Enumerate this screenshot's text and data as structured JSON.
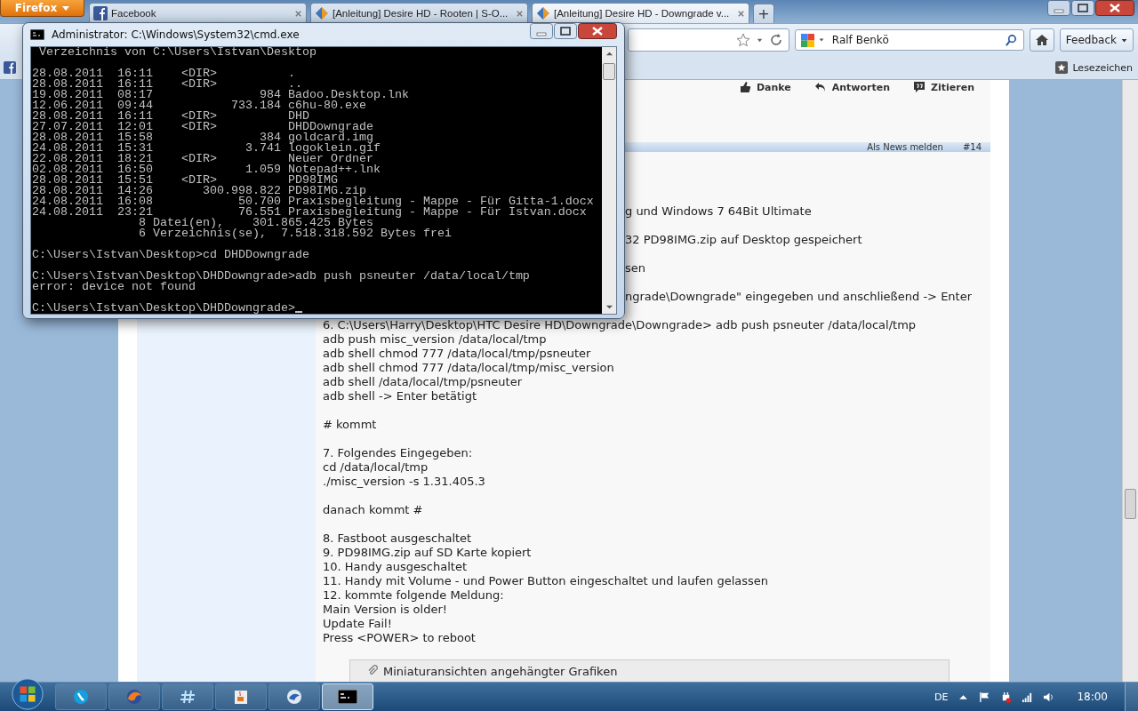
{
  "browser": {
    "menu_button": "Firefox",
    "tabs": [
      {
        "title": "Facebook",
        "kind": "square",
        "selected": false
      },
      {
        "title": "[Anleitung] Desire HD - Rooten | S-O...",
        "kind": "diamond",
        "selected": false
      },
      {
        "title": "[Anleitung] Desire HD - Downgrade v...",
        "kind": "diamond",
        "selected": true
      }
    ],
    "new_tab": "+",
    "search": {
      "value": "Ralf Benkö"
    },
    "feedback_button": "Feedback",
    "bookmarks_button": "Lesezeichen"
  },
  "console": {
    "title": "Administrator: C:\\Windows\\System32\\cmd.exe",
    "blocks": [
      [
        " Verzeichnis von C:\\Users\\Istvan\\Desktop"
      ],
      [
        "28.08.2011  16:11    <DIR>          .",
        "28.08.2011  16:11    <DIR>          ..",
        "19.08.2011  08:17               984 Badoo.Desktop.lnk",
        "12.06.2011  09:44           733.184 c6hu-80.exe",
        "28.08.2011  16:11    <DIR>          DHD",
        "27.07.2011  12:01    <DIR>          DHDDowngrade",
        "28.08.2011  15:58               384 goldcard.img",
        "24.08.2011  15:31             3.741 logoklein.gif",
        "22.08.2011  18:21    <DIR>          Neuer Ordner",
        "02.08.2011  16:50             1.059 Notepad++.lnk",
        "28.08.2011  15:51    <DIR>          PD98IMG",
        "28.08.2011  14:26       300.998.822 PD98IMG.zip",
        "24.08.2011  16:08            50.700 Praxisbegleitung - Mappe - Für Gitta-1.docx",
        "24.08.2011  23:21            76.551 Praxisbegleitung - Mappe - Für Istvan.docx",
        "               8 Datei(en),    301.865.425 Bytes",
        "               6 Verzeichnis(se),  7.518.318.592 Bytes frei"
      ],
      [
        "C:\\Users\\Istvan\\Desktop>cd DHDDowngrade"
      ],
      [
        "C:\\Users\\Istvan\\Desktop\\DHDDowngrade>adb push psneuter /data/local/tmp",
        "error: device not found"
      ],
      [
        "C:\\Users\\Istvan\\Desktop\\DHDDowngrade>"
      ]
    ]
  },
  "post_actions": [
    {
      "label": "Danke",
      "kind": "thanks"
    },
    {
      "label": "Antworten",
      "kind": "reply"
    },
    {
      "label": "Zitieren",
      "kind": "quote"
    }
  ],
  "post": {
    "report_link": "Als News melden",
    "number": "#14",
    "paragraphs": [
      {
        "cut": true,
        "lines": [
          "g und Windows 7 64Bit Ultimate"
        ]
      },
      {
        "cut": true,
        "lines": [
          "32 PD98IMG.zip auf Desktop gespeichert"
        ]
      },
      {
        "cut": true,
        "lines": [
          "sen"
        ]
      },
      {
        "cut": true,
        "lines": [
          "ngrade\\Downgrade\" eingegeben und anschließend -> Enter"
        ]
      },
      {
        "cut": false,
        "lines": [
          "6. C:\\Users\\Harry\\Desktop\\HTC Desire HD\\Downgrade\\Downgrade> adb push psneuter /data/local/tmp",
          "adb push misc_version /data/local/tmp",
          "adb shell chmod 777 /data/local/tmp/psneuter",
          "adb shell chmod 777 /data/local/tmp/misc_version",
          "adb shell /data/local/tmp/psneuter",
          "adb shell -> Enter betätigt"
        ]
      },
      {
        "cut": false,
        "lines": [
          "# kommt"
        ]
      },
      {
        "cut": false,
        "lines": [
          "7. Folgendes Eingegeben:",
          "cd /data/local/tmp",
          "./misc_version -s 1.31.405.3"
        ]
      },
      {
        "cut": false,
        "lines": [
          "danach kommt #"
        ]
      },
      {
        "cut": false,
        "lines": [
          "8. Fastboot ausgeschaltet",
          "9. PD98IMG.zip auf SD Karte kopiert",
          "10. Handy ausgeschaltet",
          "11. Handy mit Volume - und Power Button eingeschaltet und laufen gelassen",
          "12. kommte folgende Meldung:",
          "Main Version is older!",
          "Update Fail!",
          "Press <POWER> to reboot"
        ]
      }
    ],
    "attachments_title": "Miniaturansichten angehängter Grafiken"
  },
  "taskbar": {
    "apps": [
      {
        "kind": "phone",
        "selected": false
      },
      {
        "kind": "globe",
        "selected": false
      },
      {
        "kind": "hash",
        "selected": false
      },
      {
        "kind": "cup",
        "selected": false
      },
      {
        "kind": "bird",
        "selected": false
      },
      {
        "kind": "console",
        "selected": true
      }
    ],
    "language": "DE",
    "clock": "18:00"
  }
}
